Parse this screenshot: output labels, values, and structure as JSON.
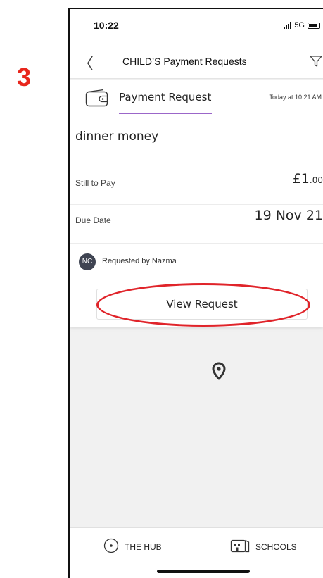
{
  "annotation": {
    "step_number": "3",
    "highlight_color": "#e0242a"
  },
  "status_bar": {
    "time": "10:22",
    "network": "5G"
  },
  "nav": {
    "title": "CHILD’S Payment Requests",
    "back_icon": "chevron-left-icon",
    "filter_icon": "filter-icon"
  },
  "card": {
    "type_label": "Payment Request",
    "timestamp": "Today at 10:21 AM",
    "title": "dinner money",
    "still_to_pay_label": "Still to Pay",
    "amount_main": "£1",
    "amount_pence": ".00",
    "due_date_label": "Due Date",
    "due_date": "19 Nov 21",
    "requester_initials": "NC",
    "requested_by": "Requested by Nazma",
    "view_button_label": "View Request",
    "accent_color": "#9b66c9"
  },
  "tab_bar": {
    "items": [
      {
        "label": "THE HUB",
        "icon": "hub-circle-icon"
      },
      {
        "label": "SCHOOLS",
        "icon": "school-building-icon"
      }
    ]
  }
}
